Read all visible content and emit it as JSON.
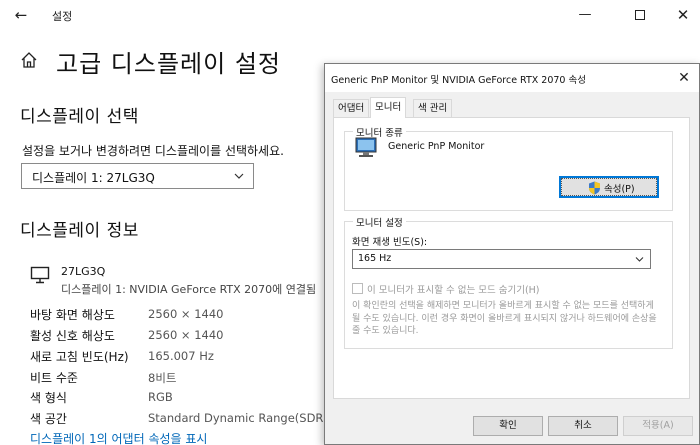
{
  "window": {
    "title": "설정",
    "back_glyph": "←",
    "min_glyph": "—",
    "close_glyph": "✕"
  },
  "page": {
    "title": "고급 디스플레이 설정"
  },
  "display_select": {
    "heading": "디스플레이 선택",
    "description": "설정을 보거나 변경하려면 디스플레이를 선택하세요.",
    "value": "디스플레이 1: 27LG3Q"
  },
  "display_info": {
    "heading": "디스플레이 정보",
    "monitor_name": "27LG3Q",
    "connection": "디스플레이 1: NVIDIA GeForce RTX 2070에 연결됨",
    "rows": [
      {
        "label": "바탕 화면 해상도",
        "value": "2560 × 1440"
      },
      {
        "label": "활성 신호 해상도",
        "value": "2560 × 1440"
      },
      {
        "label": "새로 고침 빈도(Hz)",
        "value": "165.007 Hz"
      },
      {
        "label": "비트 수준",
        "value": "8비트"
      },
      {
        "label": "색 형식",
        "value": "RGB"
      },
      {
        "label": "색 공간",
        "value": "Standard Dynamic Range(SDR)"
      }
    ],
    "adapter_link": "디스플레이 1의 어댑터 속성을 표시"
  },
  "dialog": {
    "title": "Generic PnP Monitor 및 NVIDIA GeForce RTX 2070 속성",
    "close_glyph": "✕",
    "tabs": [
      "어댑터",
      "모니터",
      "색 관리"
    ],
    "monitor_type": {
      "legend": "모니터 종류",
      "name": "Generic PnP Monitor",
      "properties_button": "속성(P)"
    },
    "monitor_settings": {
      "legend": "모니터 설정",
      "refresh_label": "화면 재생 빈도(S):",
      "refresh_value": "165 Hz",
      "hide_modes_label": "이 모니터가 표시할 수 없는 모드 숨기기(H)",
      "hide_modes_desc": "이 확인란의 선택을 해제하면 모니터가 올바르게 표시할 수 없는 모드를 선택하게 될 수도 있습니다. 이런 경우 화면이 올바르게 표시되지 않거나 하드웨어에 손상을 줄 수도 있습니다."
    },
    "buttons": {
      "ok": "확인",
      "cancel": "취소",
      "apply": "적용(A)"
    }
  },
  "colors": {
    "link": "#0067b8",
    "focus": "#0078d7",
    "dialog_bg": "#f0f0f0"
  }
}
